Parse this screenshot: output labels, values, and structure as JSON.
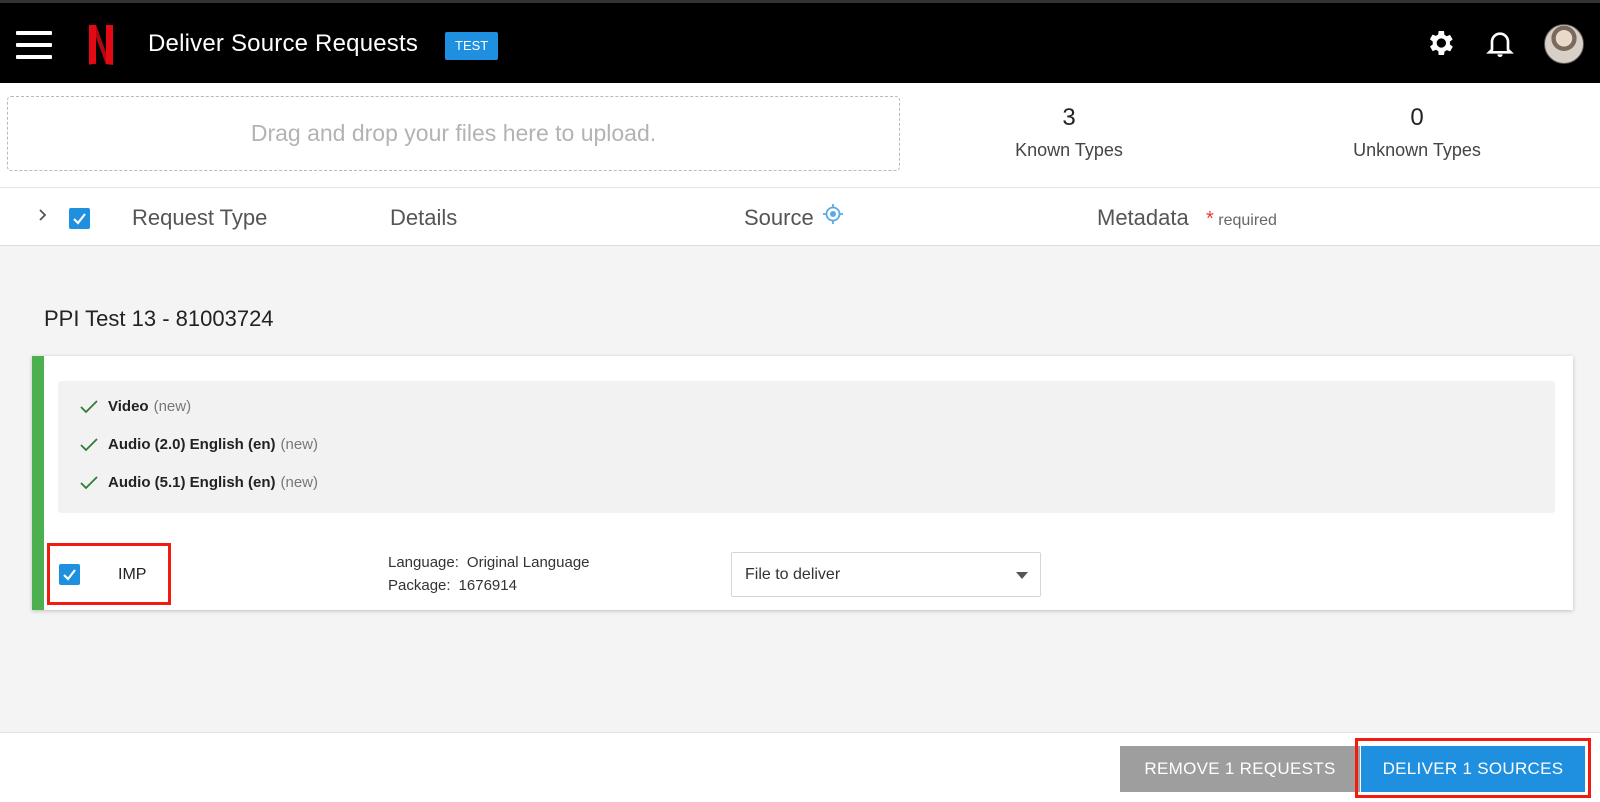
{
  "header": {
    "title": "Deliver Source Requests",
    "env_badge": "TEST"
  },
  "upload": {
    "placeholder": "Drag and drop your files here to upload."
  },
  "stats": {
    "known": {
      "count": "3",
      "label": "Known Types"
    },
    "unknown": {
      "count": "0",
      "label": "Unknown Types"
    }
  },
  "columns": {
    "request_type": "Request Type",
    "details": "Details",
    "source": "Source",
    "metadata": "Metadata",
    "required_star": "*",
    "required_label": "required"
  },
  "group": {
    "title": "PPI Test 13 - 81003724",
    "types": [
      {
        "name": "Video",
        "note": "(new)"
      },
      {
        "name": "Audio (2.0) English (en)",
        "note": "(new)"
      },
      {
        "name": "Audio (5.1) English (en)",
        "note": "(new)"
      }
    ],
    "request": {
      "type": "IMP",
      "checked": true,
      "language_label": "Language:",
      "language_value": "Original Language",
      "package_label": "Package:",
      "package_value": "1676914",
      "file_placeholder": "File to deliver"
    }
  },
  "footer": {
    "remove_label": "REMOVE 1 REQUESTS",
    "deliver_label": "DELIVER 1 SOURCES"
  },
  "colors": {
    "accent": "#1f8fe0",
    "success": "#4caf50",
    "highlight": "#f21b0f",
    "brand": "#e50914"
  },
  "icons": [
    "menu-icon",
    "netflix-logo",
    "gear-icon",
    "bell-icon",
    "avatar",
    "chevron-right-icon",
    "checkbox-icon",
    "target-icon",
    "check-icon",
    "caret-down-icon"
  ]
}
